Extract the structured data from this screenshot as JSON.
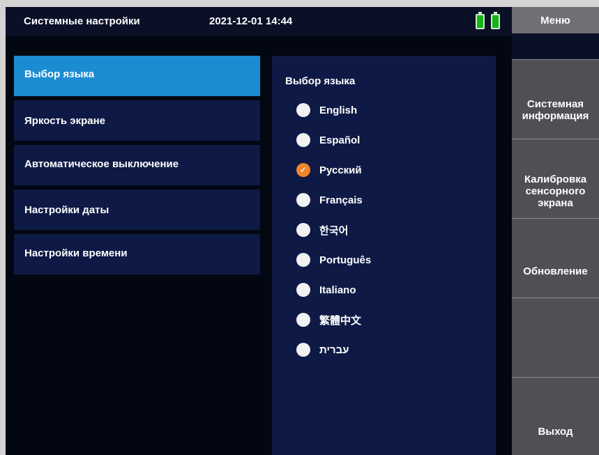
{
  "status_bar": {
    "title": "Системные настройки",
    "datetime": "2021-12-01 14:44",
    "battery_color": "#16b516"
  },
  "settings_menu": {
    "items": [
      {
        "label": "Выбор языка",
        "active": true
      },
      {
        "label": "Яркость экране",
        "active": false
      },
      {
        "label": "Автоматическое выключение",
        "active": false
      },
      {
        "label": "Настройки даты",
        "active": false
      },
      {
        "label": "Настройки времени",
        "active": false
      }
    ]
  },
  "language_panel": {
    "title": "Выбор языка",
    "options": [
      {
        "label": "English",
        "selected": false
      },
      {
        "label": "Español",
        "selected": false
      },
      {
        "label": "Русский",
        "selected": true
      },
      {
        "label": "Français",
        "selected": false
      },
      {
        "label": "한국어",
        "selected": false
      },
      {
        "label": "Português",
        "selected": false
      },
      {
        "label": "Italiano",
        "selected": false
      },
      {
        "label": "繁體中文",
        "selected": false
      },
      {
        "label": "עברית",
        "selected": false
      }
    ],
    "selected_color": "#f0842a",
    "check_glyph": "✓"
  },
  "side_menu": {
    "header": "Меню",
    "buttons": [
      {
        "label": "Системная\nинформация"
      },
      {
        "label": "Калибровка\nсенсорного\nэкрана"
      },
      {
        "label": "Обновление"
      },
      {
        "label": ""
      },
      {
        "label": "Выход"
      }
    ]
  },
  "colors": {
    "active_item": "#1c8cd2",
    "panel": "#0e1a45",
    "screen_bg": "#030712",
    "side_button": "#4f4f56"
  }
}
